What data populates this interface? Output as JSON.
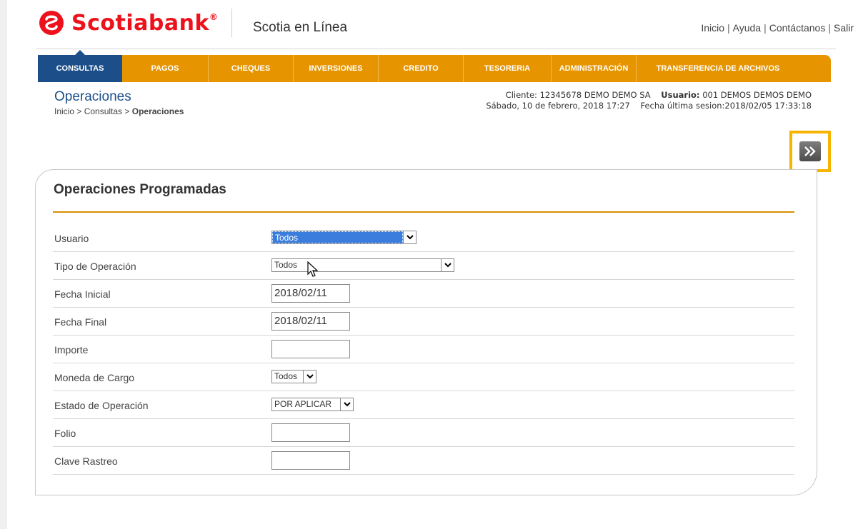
{
  "brand": {
    "name": "Scotiabank",
    "mark": "®",
    "color": "#ec111a"
  },
  "header": {
    "product": "Scotia en Línea",
    "links": [
      "Inicio",
      "Ayuda",
      "Contáctanos",
      "Salir"
    ],
    "separator": "|"
  },
  "nav": {
    "active_index": 0,
    "items": [
      "CONSULTAS",
      "PAGOS",
      "CHEQUES",
      "INVERSIONES",
      "CREDITO",
      "TESORERIA",
      "ADMINISTRACIÓN",
      "TRANSFERENCIA DE ARCHIVOS"
    ]
  },
  "page": {
    "title": "Operaciones",
    "breadcrumb": {
      "prefix": "Inicio > Consultas > ",
      "current": "Operaciones"
    }
  },
  "session": {
    "cliente_label": "Cliente:",
    "cliente_value": "12345678 DEMO DEMO SA",
    "usuario_label": "Usuario:",
    "usuario_value": "001 DEMOS DEMOS DEMO",
    "date": "Sábado, 10 de febrero, 2018 17:27",
    "last_session_label": "Fecha última sesion:",
    "last_session_value": "2018/02/05 17:33:18"
  },
  "panel": {
    "title": "Operaciones Programadas",
    "fields": {
      "usuario": {
        "label": "Usuario",
        "value": "Todos"
      },
      "tipo": {
        "label": "Tipo de Operación",
        "value": "Todos"
      },
      "fecha_inicial": {
        "label": "Fecha Inicial",
        "value": "2018/02/11"
      },
      "fecha_final": {
        "label": "Fecha Final",
        "value": "2018/02/11"
      },
      "importe": {
        "label": "Importe",
        "value": ""
      },
      "moneda": {
        "label": "Moneda de Cargo",
        "value": "Todos"
      },
      "estado": {
        "label": "Estado de Operación",
        "value": "POR APLICAR"
      },
      "folio": {
        "label": "Folio",
        "value": ""
      },
      "clave": {
        "label": "Clave Rastreo",
        "value": ""
      }
    }
  },
  "colors": {
    "nav_orange": "#e69500",
    "nav_active": "#1c4f8a",
    "highlight_frame": "#f6b400",
    "rule": "#d48f00"
  }
}
